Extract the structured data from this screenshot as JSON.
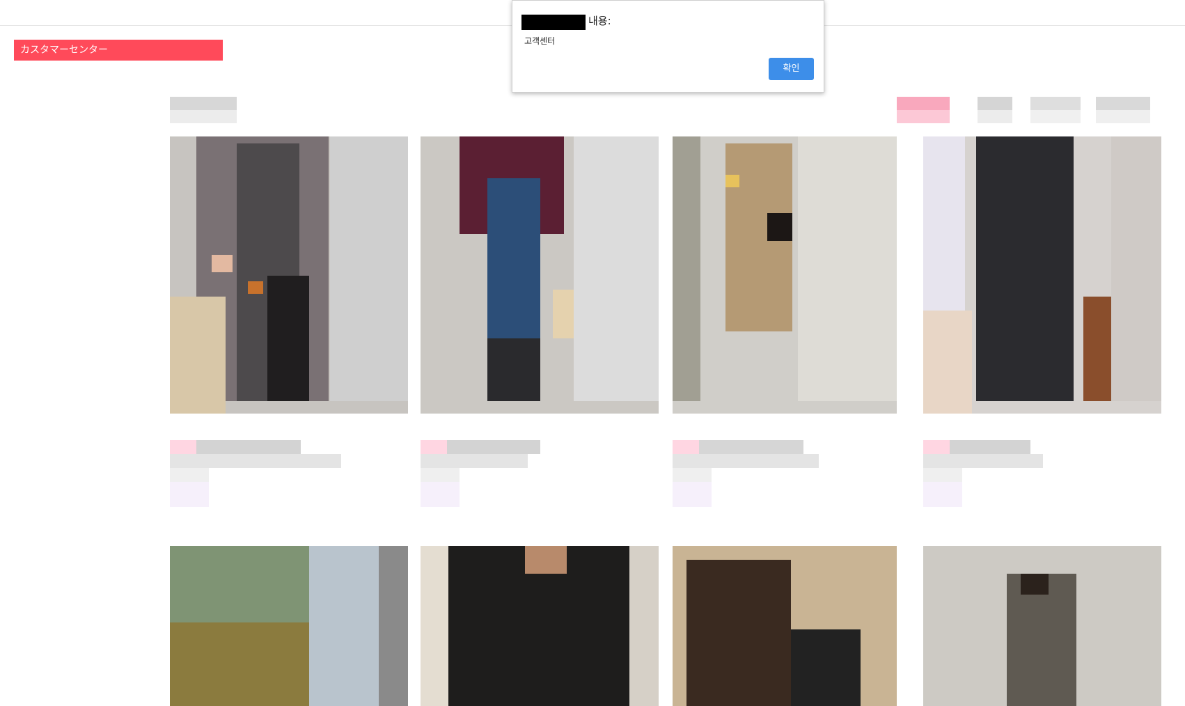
{
  "sidebar": {
    "customer_center_label": "カスタマーセンター"
  },
  "dialog": {
    "title_suffix": "내용:",
    "message": "고객센터",
    "ok_label": "확인"
  },
  "colors": {
    "accent_pink": "#ff4a5a",
    "dialog_button": "#3d8ee9"
  }
}
